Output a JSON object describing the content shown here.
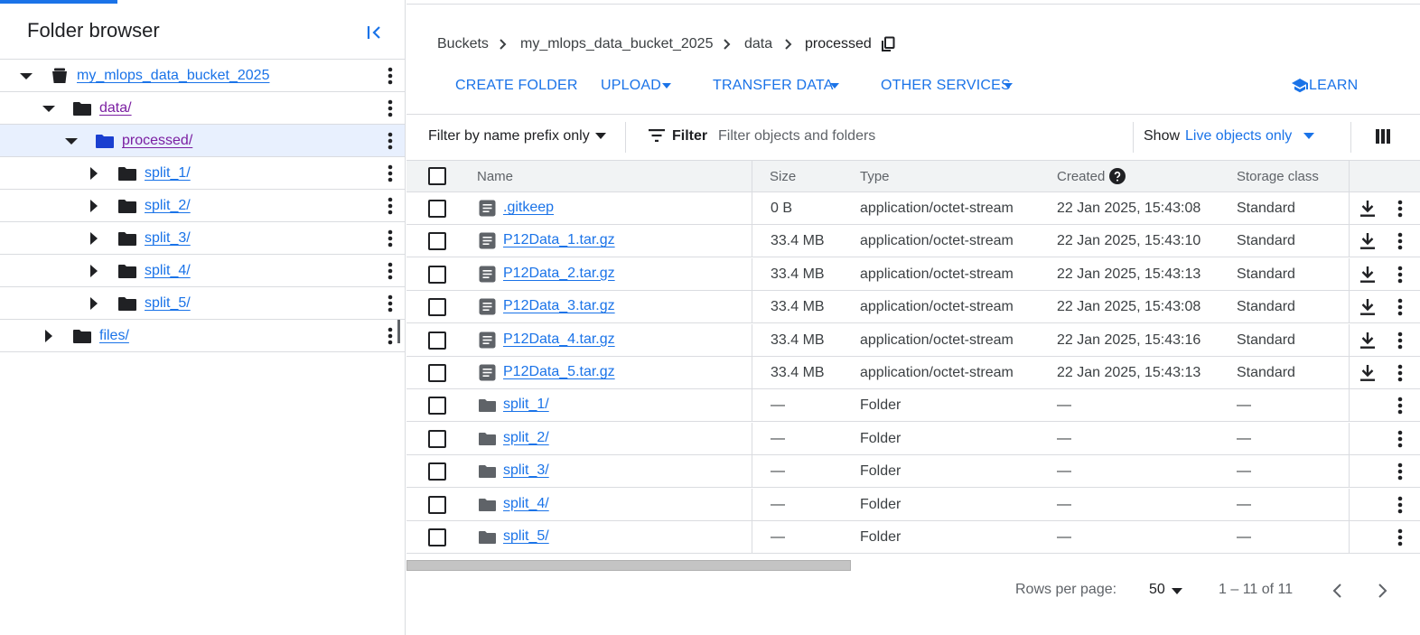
{
  "left_panel": {
    "title": "Folder browser",
    "tree": [
      {
        "label": "my_mlops_data_bucket_2025",
        "expanded": true,
        "kind": "bucket"
      },
      {
        "label": "data/",
        "expanded": true,
        "kind": "folder"
      },
      {
        "label": "processed/",
        "expanded": true,
        "kind": "folder",
        "selected": true
      },
      {
        "label": "split_1/",
        "expanded": false,
        "kind": "folder"
      },
      {
        "label": "split_2/",
        "expanded": false,
        "kind": "folder"
      },
      {
        "label": "split_3/",
        "expanded": false,
        "kind": "folder"
      },
      {
        "label": "split_4/",
        "expanded": false,
        "kind": "folder"
      },
      {
        "label": "split_5/",
        "expanded": false,
        "kind": "folder"
      },
      {
        "label": "files/",
        "expanded": false,
        "kind": "folder"
      }
    ]
  },
  "breadcrumb": {
    "items": [
      "Buckets",
      "my_mlops_data_bucket_2025",
      "data",
      "processed"
    ]
  },
  "actions": {
    "create_folder": "CREATE FOLDER",
    "upload": "UPLOAD",
    "transfer_data": "TRANSFER DATA",
    "other_services": "OTHER SERVICES",
    "learn": "LEARN"
  },
  "filter_bar": {
    "prefix_mode": "Filter by name prefix only",
    "filter_label": "Filter",
    "placeholder": "Filter objects and folders",
    "show_label": "Show",
    "show_value": "Live objects only"
  },
  "table": {
    "headers": {
      "name": "Name",
      "size": "Size",
      "type": "Type",
      "created": "Created",
      "storage_class": "Storage class"
    },
    "rows": [
      {
        "name": ".gitkeep",
        "size": "0 B",
        "type": "application/octet-stream",
        "created": "22 Jan 2025, 15:43:08",
        "storage_class": "Standard",
        "kind": "file"
      },
      {
        "name": "P12Data_1.tar.gz",
        "size": "33.4 MB",
        "type": "application/octet-stream",
        "created": "22 Jan 2025, 15:43:10",
        "storage_class": "Standard",
        "kind": "file"
      },
      {
        "name": "P12Data_2.tar.gz",
        "size": "33.4 MB",
        "type": "application/octet-stream",
        "created": "22 Jan 2025, 15:43:13",
        "storage_class": "Standard",
        "kind": "file"
      },
      {
        "name": "P12Data_3.tar.gz",
        "size": "33.4 MB",
        "type": "application/octet-stream",
        "created": "22 Jan 2025, 15:43:08",
        "storage_class": "Standard",
        "kind": "file"
      },
      {
        "name": "P12Data_4.tar.gz",
        "size": "33.4 MB",
        "type": "application/octet-stream",
        "created": "22 Jan 2025, 15:43:16",
        "storage_class": "Standard",
        "kind": "file"
      },
      {
        "name": "P12Data_5.tar.gz",
        "size": "33.4 MB",
        "type": "application/octet-stream",
        "created": "22 Jan 2025, 15:43:13",
        "storage_class": "Standard",
        "kind": "file"
      },
      {
        "name": "split_1/",
        "size": "—",
        "type": "Folder",
        "created": "—",
        "storage_class": "—",
        "kind": "folder"
      },
      {
        "name": "split_2/",
        "size": "—",
        "type": "Folder",
        "created": "—",
        "storage_class": "—",
        "kind": "folder"
      },
      {
        "name": "split_3/",
        "size": "—",
        "type": "Folder",
        "created": "—",
        "storage_class": "—",
        "kind": "folder"
      },
      {
        "name": "split_4/",
        "size": "—",
        "type": "Folder",
        "created": "—",
        "storage_class": "—",
        "kind": "folder"
      },
      {
        "name": "split_5/",
        "size": "—",
        "type": "Folder",
        "created": "—",
        "storage_class": "—",
        "kind": "folder"
      }
    ]
  },
  "pagination": {
    "rows_per_page_label": "Rows per page:",
    "rows_per_page_value": "50",
    "range": "1 – 11 of 11"
  },
  "colors": {
    "accent": "#1a73e8",
    "selected_bg": "#e8f0fe",
    "visited_link": "#7b1fa2",
    "selected_folder_icon": "#1a3fd0"
  },
  "icons": {
    "collapse": "collapse-panel-icon",
    "bucket": "bucket-icon",
    "folder": "folder-icon",
    "file": "file-icon",
    "copy": "copy-icon",
    "learn": "school-icon",
    "filter": "filter-icon",
    "columns": "column-display-icon",
    "help": "help-icon",
    "download": "download-icon",
    "more": "more-vert-icon"
  }
}
